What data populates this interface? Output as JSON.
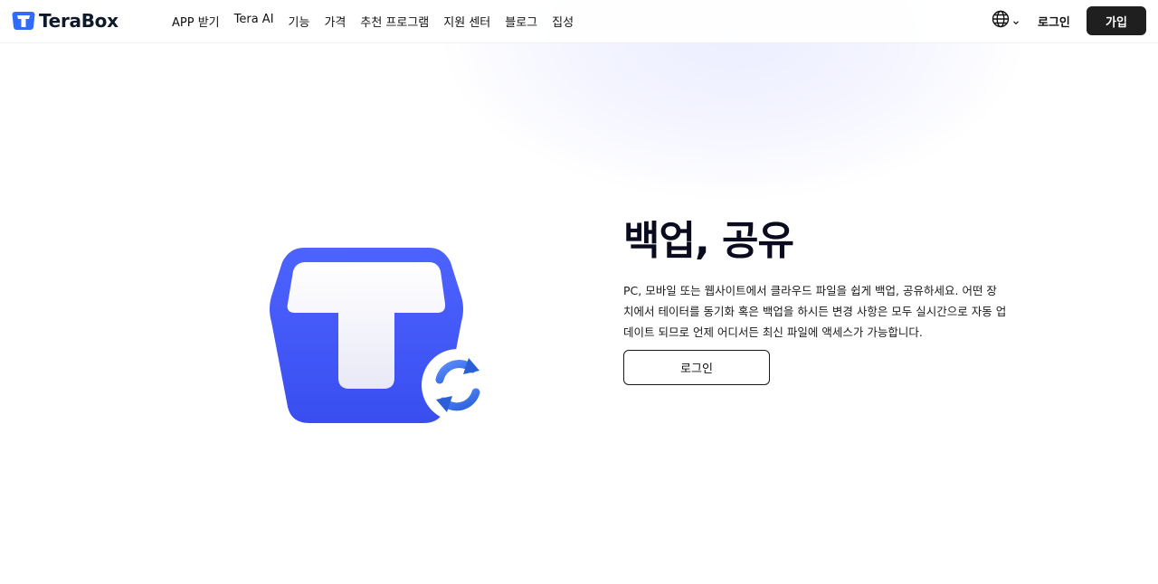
{
  "brand": {
    "name": "TeraBox",
    "icon": "terabox-logo-icon",
    "color": "#3b5bfd"
  },
  "nav": [
    {
      "label": "APP 받기"
    },
    {
      "label": "Tera AI"
    },
    {
      "label": "기능"
    },
    {
      "label": "가격"
    },
    {
      "label": "추천 프로그램"
    },
    {
      "label": "지원 센터"
    },
    {
      "label": "블로그"
    },
    {
      "label": "집성"
    }
  ],
  "header": {
    "language_icon": "globe-icon",
    "login_label": "로그인",
    "signup_label": "가입"
  },
  "hero": {
    "title": "백업, 공유",
    "description": "PC, 모바일 또는 웹사이트에서 클라우드 파일을 쉽게 백업, 공유하세요. 어떤 장치에서 테이터를 동기화 혹은 백업을 하시든 변경 사항은 모두 실시간으로 자동 업데이트 되므로 언제 어디서든 최신 파일에 액세스가 가능합니다.",
    "login_button": "로그인",
    "illustration": "terabox-sync-icon"
  },
  "colors": {
    "accent": "#3b5bfd",
    "dark_button": "#1f1f1f"
  }
}
